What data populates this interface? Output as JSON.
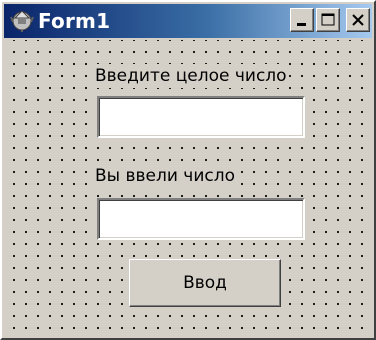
{
  "window": {
    "title": "Form1",
    "icon": "delphi-helmet-icon",
    "caption_buttons": [
      "minimize-icon",
      "maximize-icon",
      "close-icon"
    ],
    "colors": {
      "titlebar_start": "#0a246a",
      "titlebar_end": "#a6caf0",
      "face": "#d4d0c8"
    }
  },
  "form": {
    "input_label": "Введите целое число",
    "input_value": "",
    "output_label": "Вы ввели число",
    "output_value": "",
    "enter_button_label": "Ввод"
  }
}
